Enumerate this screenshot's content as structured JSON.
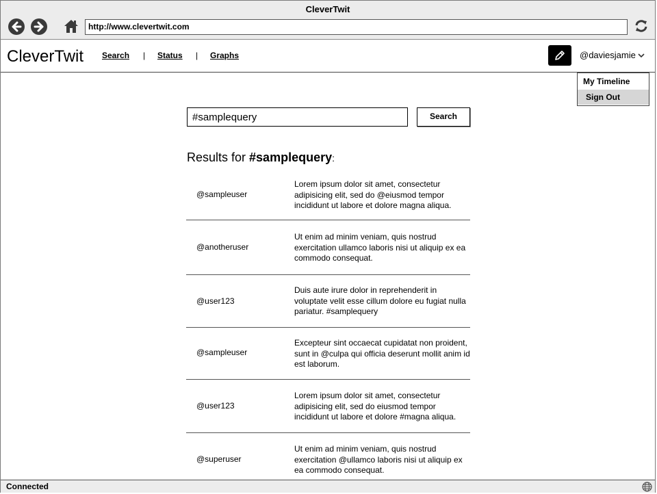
{
  "window": {
    "title": "CleverTwit"
  },
  "browser": {
    "url": "http://www.clevertwit.com",
    "icons": [
      "back-icon",
      "forward-icon",
      "home-icon",
      "reload-icon"
    ]
  },
  "app": {
    "logo": "CleverTwit",
    "nav": [
      {
        "label": "Search"
      },
      {
        "label": "Status"
      },
      {
        "label": "Graphs"
      }
    ],
    "nav_separator": "|",
    "compose_icon": "pencil-icon",
    "user": "@daviesjamie",
    "user_menu_icon": "chevron-down-icon"
  },
  "dropdown": {
    "items": [
      {
        "label": "My Timeline"
      },
      {
        "label": "Sign Out"
      }
    ]
  },
  "search": {
    "query": "#samplequery",
    "button_label": "Search"
  },
  "results": {
    "heading_prefix": "Results for ",
    "heading_query": "#samplequery",
    "heading_suffix": ":",
    "items": [
      {
        "user": "@sampleuser",
        "text": "Lorem ipsum dolor sit amet, consectetur adipisicing elit, sed do @eiusmod tempor incididunt ut labore et dolore magna aliqua."
      },
      {
        "user": "@anotheruser",
        "text": "Ut enim ad minim veniam, quis nostrud exercitation ullamco laboris nisi ut aliquip ex ea commodo consequat."
      },
      {
        "user": "@user123",
        "text": "Duis aute irure dolor in reprehenderit in voluptate velit esse cillum dolore eu fugiat nulla pariatur. #samplequery"
      },
      {
        "user": "@sampleuser",
        "text": "Excepteur sint occaecat cupidatat non proident, sunt in @culpa qui officia deserunt mollit anim id est laborum."
      },
      {
        "user": "@user123",
        "text": "Lorem ipsum dolor sit amet, consectetur adipisicing elit, sed do eiusmod tempor incididunt ut labore et dolore #magna aliqua."
      },
      {
        "user": "@superuser",
        "text": "Ut enim ad minim veniam, quis nostrud exercitation @ullamco laboris nisi ut aliquip ex ea commodo consequat."
      }
    ]
  },
  "statusbar": {
    "text": "Connected",
    "icon": "globe-icon"
  }
}
